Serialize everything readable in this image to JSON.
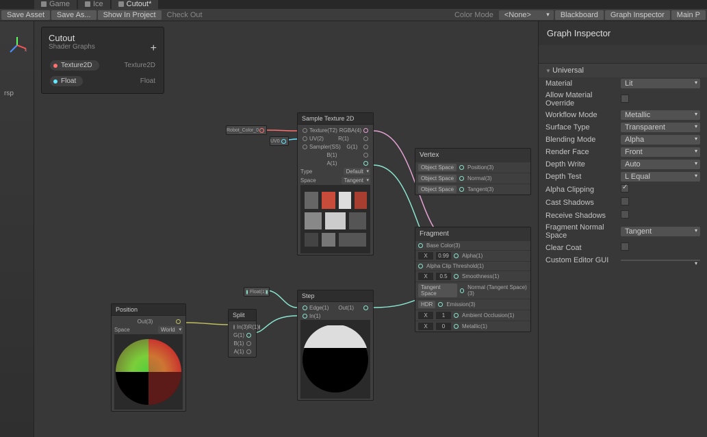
{
  "tabs": [
    {
      "label": "Game",
      "active": false
    },
    {
      "label": "Ice",
      "active": false
    },
    {
      "label": "Cutout*",
      "active": true
    }
  ],
  "toolbar": {
    "save": "Save Asset",
    "saveAs": "Save As...",
    "showInProject": "Show In Project",
    "checkOut": "Check Out",
    "colorMode": "Color Mode",
    "colorModeVal": "<None>",
    "blackboard": "Blackboard",
    "graphInspector": "Graph Inspector",
    "mainPreview": "Main P"
  },
  "sceneStrip": {
    "persp": "rsp"
  },
  "blackboard": {
    "title": "Cutout",
    "subtitle": "Shader Graphs",
    "props": [
      {
        "name": "Texture2D",
        "type": "Texture2D",
        "dot": "red"
      },
      {
        "name": "Float",
        "type": "Float",
        "dot": "cyan"
      }
    ]
  },
  "propNode": {
    "label": "Robot_Color_0"
  },
  "floatProp": {
    "label": "Float(1)"
  },
  "uv0": "UV0",
  "sampleTex": {
    "title": "Sample Texture 2D",
    "inputs": [
      "Texture(T2)",
      "UV(2)",
      "Sampler(SS)"
    ],
    "outputs": [
      "RGBA(4)",
      "R(1)",
      "G(1)",
      "B(1)",
      "A(1)"
    ],
    "type": "Type",
    "typeVal": "Default",
    "space": "Space",
    "spaceVal": "Tangent"
  },
  "positionNode": {
    "title": "Position",
    "out": "Out(3)",
    "space": "Space",
    "spaceVal": "World"
  },
  "splitNode": {
    "title": "Split",
    "in": "In(3)",
    "outs": [
      "R(1)",
      "G(1)",
      "B(1)",
      "A(1)"
    ]
  },
  "stepNode": {
    "title": "Step",
    "inputs": [
      "Edge(1)",
      "In(1)"
    ],
    "out": "Out(1)"
  },
  "vertex": {
    "title": "Vertex",
    "rows": [
      {
        "chip": "Object Space",
        "label": "Position(3)"
      },
      {
        "chip": "Object Space",
        "label": "Normal(3)"
      },
      {
        "chip": "Object Space",
        "label": "Tangent(3)"
      }
    ]
  },
  "fragment": {
    "title": "Fragment",
    "rows": [
      {
        "label": "Base Color(3)"
      },
      {
        "chipX": "X",
        "val": "0.99",
        "label": "Alpha(1)"
      },
      {
        "label": "Alpha Clip Threshold(1)"
      },
      {
        "chipX": "X",
        "val": "0.5",
        "label": "Smoothness(1)"
      },
      {
        "chip": "Tangent Space",
        "label": "Normal (Tangent Space)(3)"
      },
      {
        "chip": "HDR",
        "label": "Emission(3)"
      },
      {
        "chipX": "X",
        "val": "1",
        "label": "Ambient Occlusion(1)"
      },
      {
        "chipX": "X",
        "val": "0",
        "label": "Metallic(1)"
      }
    ]
  },
  "inspector": {
    "title": "Graph Inspector",
    "section": "Universal",
    "rows": [
      {
        "label": "Material",
        "type": "drop",
        "val": "Lit"
      },
      {
        "label": "Allow Material Override",
        "type": "chk",
        "val": false
      },
      {
        "label": "Workflow Mode",
        "type": "drop",
        "val": "Metallic"
      },
      {
        "label": "Surface Type",
        "type": "drop",
        "val": "Transparent"
      },
      {
        "label": "Blending Mode",
        "type": "drop",
        "val": "Alpha"
      },
      {
        "label": "Render Face",
        "type": "drop",
        "val": "Front"
      },
      {
        "label": "Depth Write",
        "type": "drop",
        "val": "Auto"
      },
      {
        "label": "Depth Test",
        "type": "drop",
        "val": "L Equal"
      },
      {
        "label": "Alpha Clipping",
        "type": "chk",
        "val": true
      },
      {
        "label": "Cast Shadows",
        "type": "chk",
        "val": false
      },
      {
        "label": "Receive Shadows",
        "type": "chk",
        "val": false
      },
      {
        "label": "Fragment Normal Space",
        "type": "drop",
        "val": "Tangent"
      },
      {
        "label": "Clear Coat",
        "type": "chk",
        "val": false
      },
      {
        "label": "Custom Editor GUI",
        "type": "text",
        "val": ""
      }
    ]
  }
}
